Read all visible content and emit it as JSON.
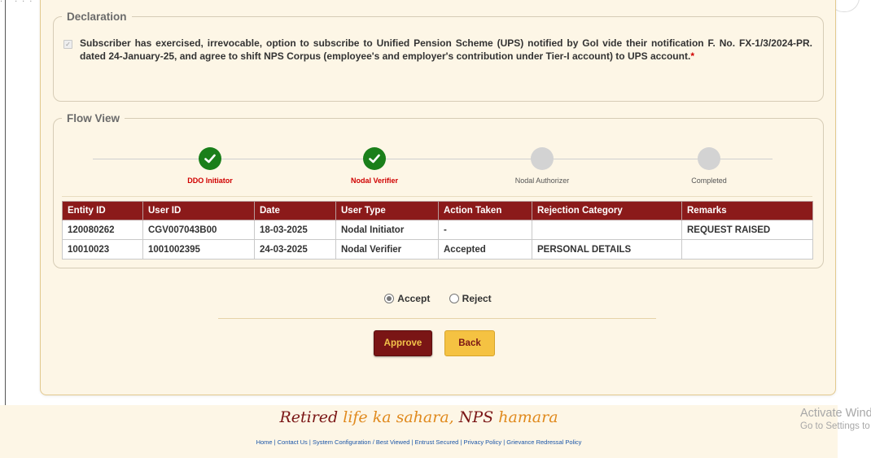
{
  "declaration": {
    "legend": "Declaration",
    "text": "Subscriber has exercised, irrevocable, option to subscribe to Unified Pension Scheme (UPS) notified by GoI vide their notification F. No. FX-1/3/2024-PR. dated 24-January-25, and agree to shift NPS Corpus (employee's and employer's contribution under Tier-I account) to UPS account.",
    "required_mark": "*",
    "checked": true
  },
  "flow": {
    "legend": "Flow View",
    "steps": [
      {
        "label": "DDO Initiator",
        "status": "done"
      },
      {
        "label": "Nodal Verifier",
        "status": "done"
      },
      {
        "label": "Nodal Authorizer",
        "status": "pending"
      },
      {
        "label": "Completed",
        "status": "pending"
      }
    ],
    "table": {
      "headers": [
        "Entity ID",
        "User ID",
        "Date",
        "User Type",
        "Action Taken",
        "Rejection Category",
        "Remarks"
      ],
      "rows": [
        [
          "120080262",
          "CGV007043B00",
          "18-03-2025",
          "Nodal Initiator",
          "-",
          "",
          "REQUEST RAISED"
        ],
        [
          "10010023",
          "1001002395",
          "24-03-2025",
          "Nodal Verifier",
          "Accepted",
          "PERSONAL DETAILS",
          ""
        ]
      ]
    }
  },
  "decision": {
    "accept_label": "Accept",
    "reject_label": "Reject",
    "selected": "accept"
  },
  "buttons": {
    "approve": "Approve",
    "back": "Back"
  },
  "footer": {
    "tagline_part1": "Retired ",
    "tagline_part2": "life ka sahara, ",
    "tagline_part3": "NPS ",
    "tagline_part4": "hamara",
    "links": [
      "Home",
      "Contact Us",
      "System Configuration / Best Viewed",
      "Entrust Secured",
      "Privacy Policy",
      "Grievance Redressal Policy"
    ]
  },
  "watermark": {
    "line1": "Activate Windows",
    "line2": "Go to Settings to activate Windows."
  },
  "colors": {
    "header_maroon": "#8b1a1a",
    "done_green": "#1a7f1a",
    "accent_gold": "#f5c242"
  }
}
